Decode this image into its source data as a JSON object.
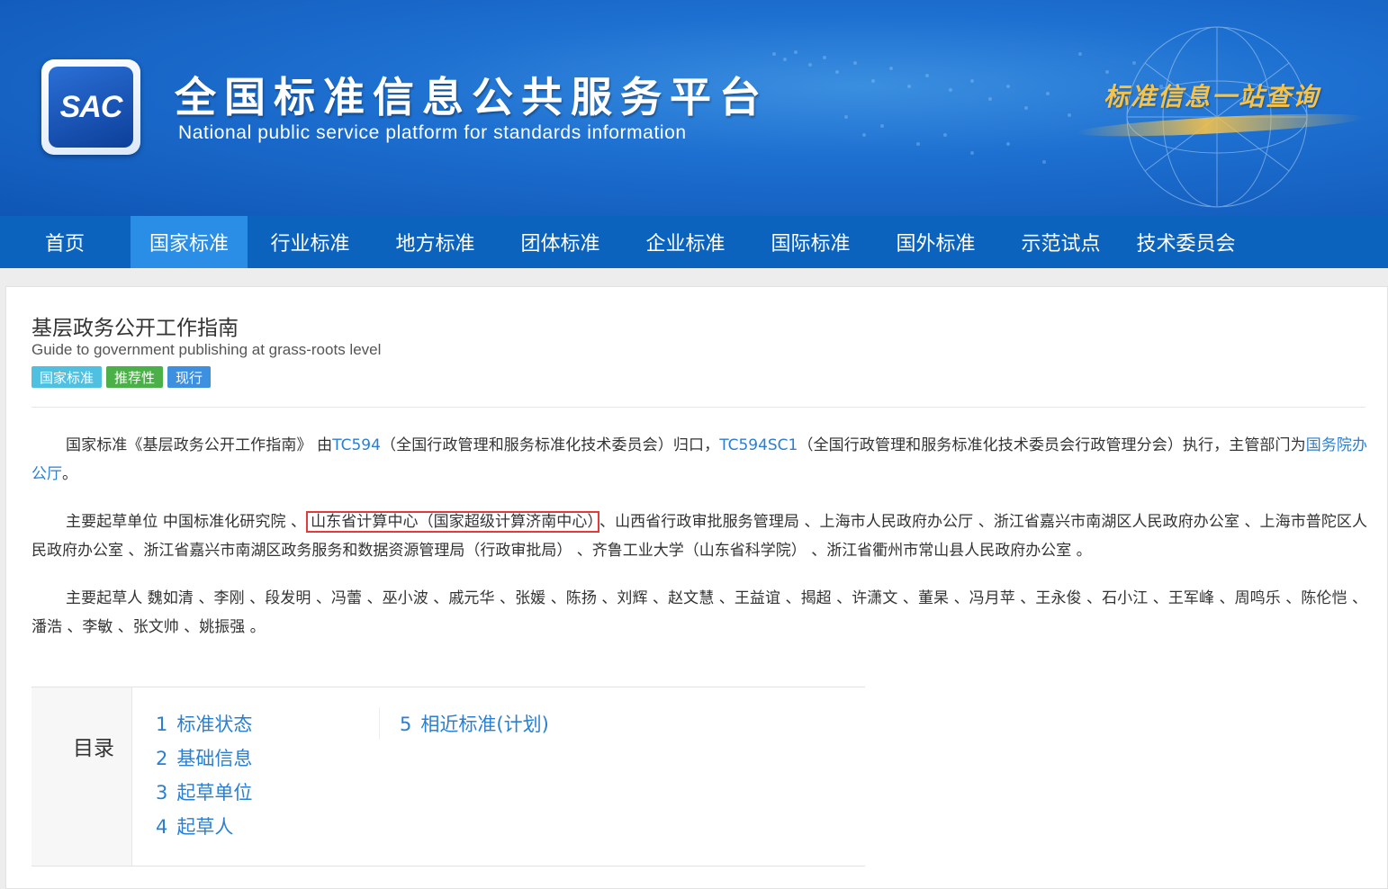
{
  "header": {
    "logo_text": "SAC",
    "title": "全国标准信息公共服务平台",
    "subtitle": "National public service platform  for standards information",
    "slogan": "标准信息一站查询"
  },
  "nav": {
    "items": [
      {
        "label": "首页"
      },
      {
        "label": "国家标准",
        "active": true
      },
      {
        "label": "行业标准"
      },
      {
        "label": "地方标准"
      },
      {
        "label": "团体标准"
      },
      {
        "label": "企业标准"
      },
      {
        "label": "国际标准"
      },
      {
        "label": "国外标准"
      },
      {
        "label": "示范试点"
      },
      {
        "label": "技术委员会"
      }
    ]
  },
  "standard": {
    "title": "基层政务公开工作指南",
    "title_en": "Guide to government publishing at grass-roots level",
    "tags": [
      "国家标准",
      "推荐性",
      "现行"
    ]
  },
  "paragraphs": {
    "p1": {
      "t1": "国家标准《基层政务公开工作指南》 由",
      "link1": "TC594",
      "t2": "（全国行政管理和服务标准化技术委员会）归口，",
      "link2": "TC594SC1",
      "t3": "（全国行政管理和服务标准化技术委员会行政管理分会）执行，主管部门为",
      "link3": "国务院办公厅",
      "t4": "。"
    },
    "p2": {
      "prefix": "主要起草单位 中国标准化研究院 、",
      "highlighted": "山东省计算中心（国家超级计算济南中心）",
      "rest": "、山西省行政审批服务管理局 、上海市人民政府办公厅 、浙江省嘉兴市南湖区人民政府办公室 、上海市普陀区人民政府办公室 、浙江省嘉兴市南湖区政务服务和数据资源管理局（行政审批局） 、齐鲁工业大学（山东省科学院） 、浙江省衢州市常山县人民政府办公室 。"
    },
    "p3": {
      "text": "主要起草人 魏如清 、李刚 、段发明 、冯蕾 、巫小波 、戚元华 、张媛 、陈扬 、刘辉 、赵文慧 、王益谊 、揭超 、许潇文 、董杲 、冯月苹 、王永俊 、石小江 、王军峰 、周鸣乐 、陈伦恺 、潘浩 、李敏 、张文帅 、姚振强 。"
    }
  },
  "toc": {
    "heading": "目录",
    "col1": [
      {
        "num": "1",
        "label": "标准状态"
      },
      {
        "num": "2",
        "label": "基础信息"
      },
      {
        "num": "3",
        "label": "起草单位"
      },
      {
        "num": "4",
        "label": "起草人"
      }
    ],
    "col2": [
      {
        "num": "5",
        "label": "相近标准(计划)"
      }
    ]
  },
  "colors": {
    "nav_bg": "#0c63bd",
    "nav_active": "#2b8ee6",
    "link": "#2a7fd1",
    "highlight_border": "#e23b3b",
    "tag_national": "#4fc0e0",
    "tag_recommended": "#4cb049",
    "tag_current": "#3d8fe0"
  }
}
